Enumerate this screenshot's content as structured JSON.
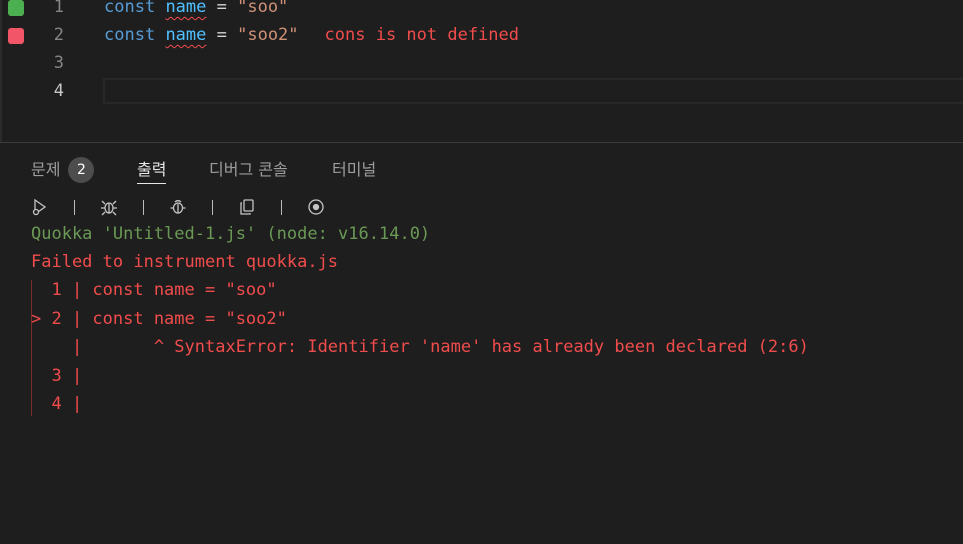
{
  "editor": {
    "lines": [
      {
        "number": "1",
        "marker_color": "#4caf50",
        "keyword": "const",
        "name": "name",
        "op": " = ",
        "string": "\"soo\"",
        "inline_error": ""
      },
      {
        "number": "2",
        "marker_color": "#f14c4c",
        "keyword": "const",
        "name": "name",
        "op": " = ",
        "string": "\"soo2\"",
        "inline_error": "cons is not defined"
      },
      {
        "number": "3"
      },
      {
        "number": "4"
      }
    ]
  },
  "panel": {
    "tabs": {
      "problems": {
        "label": "문제",
        "badge": "2"
      },
      "output": {
        "label": "출력"
      },
      "debug_console": {
        "label": "디버그 콘솔"
      },
      "terminal": {
        "label": "터미널"
      }
    },
    "toolbar_icons": [
      "run-icon",
      "debug-icon",
      "bug-icon",
      "copy-icon",
      "stop-record-icon"
    ],
    "output": {
      "header": "Quokka 'Untitled-1.js' (node: v16.14.0)",
      "error": "Failed to instrument quokka.js",
      "code_frame": [
        "  1 | const name = \"soo\"",
        "> 2 | const name = \"soo2\"",
        "    |       ^ SyntaxError: Identifier 'name' has already been declared (2:6)",
        "  3 |",
        "  4 |"
      ]
    }
  },
  "colors": {
    "background": "#1e1e1e",
    "keyword": "#569cd6",
    "variable": "#4fc1ff",
    "string": "#ce9178",
    "error": "#f14c4c",
    "quokka_header": "#6a9955"
  }
}
